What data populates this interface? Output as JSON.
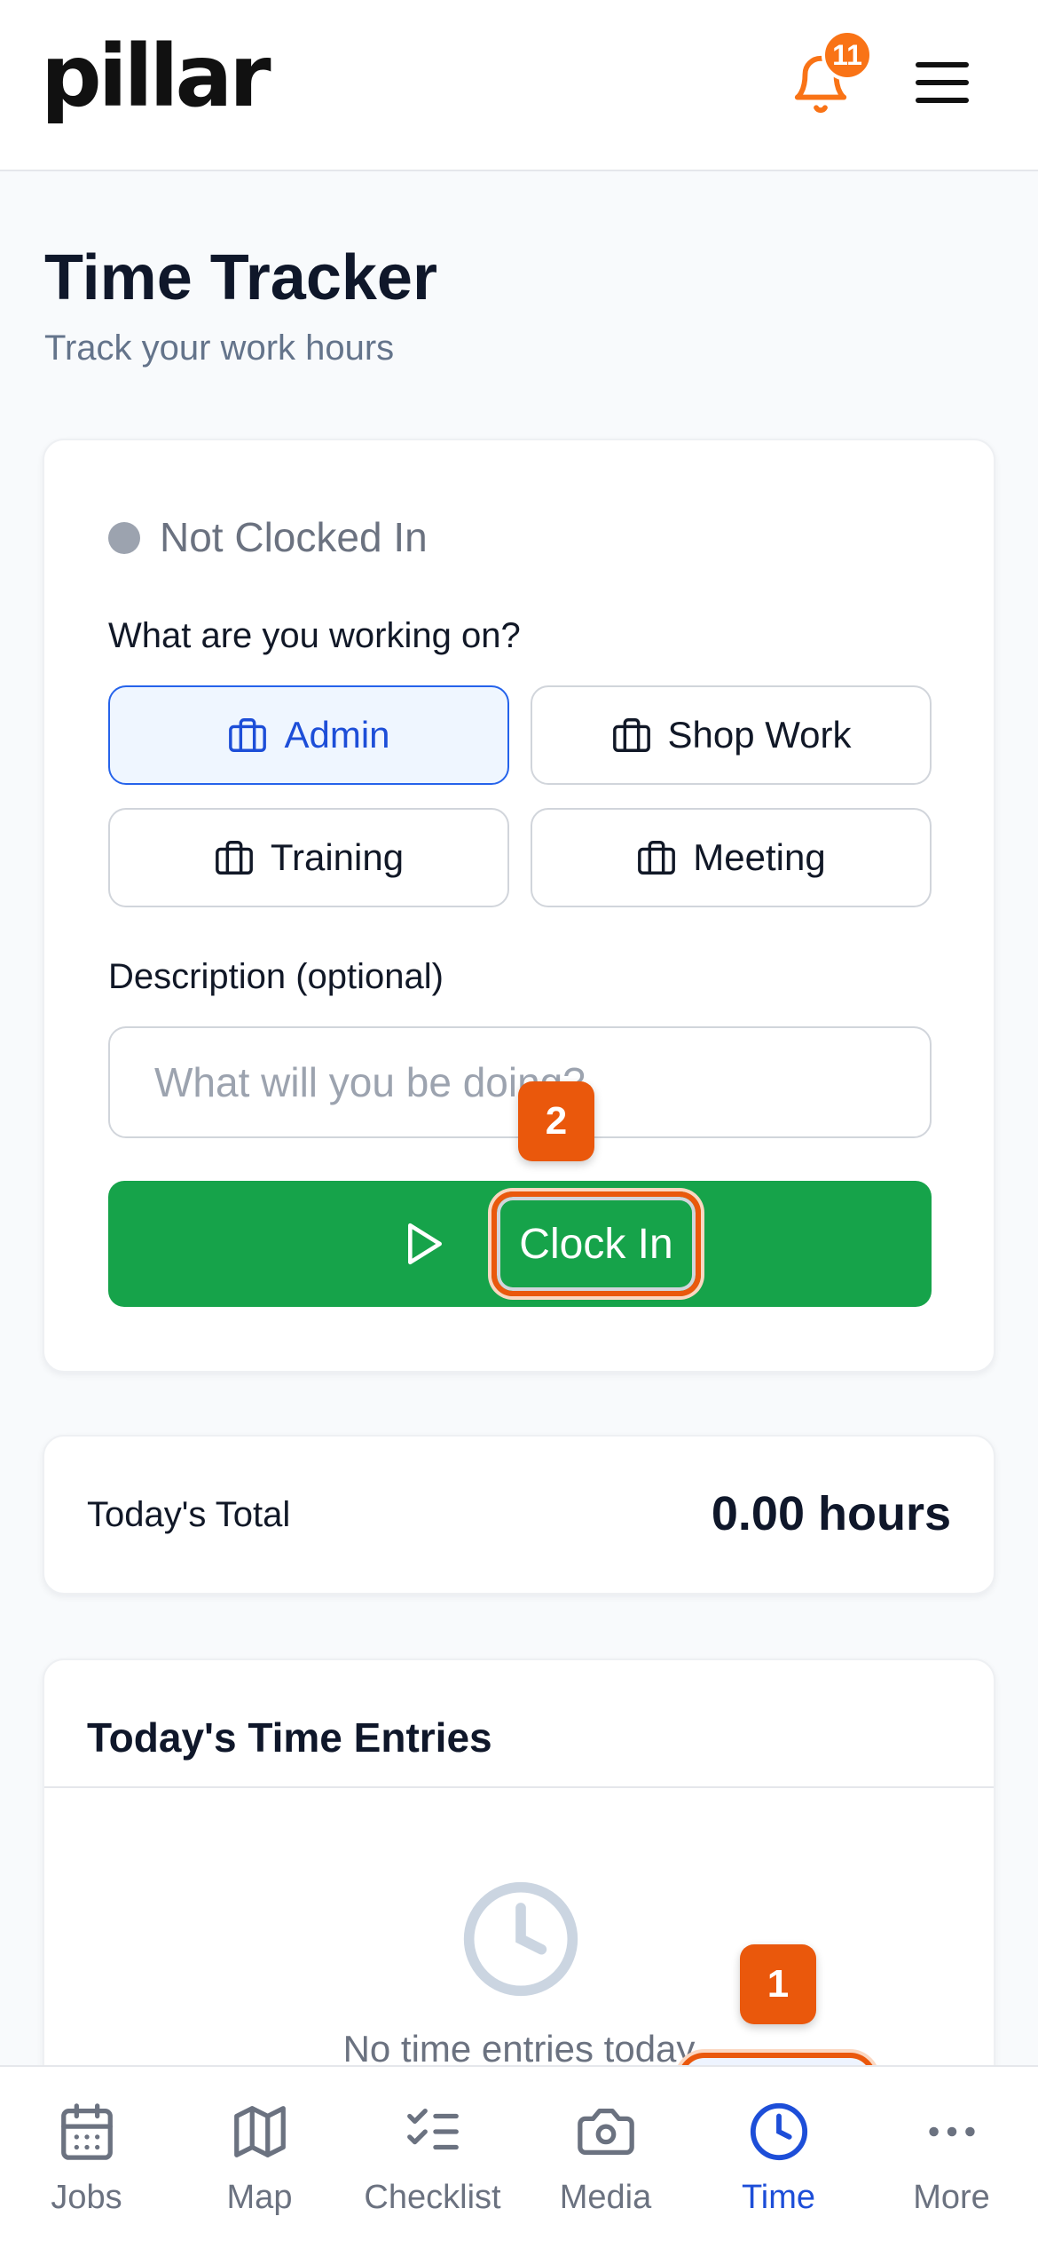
{
  "header": {
    "logo": "pillar",
    "notification_count": "11"
  },
  "page": {
    "title": "Time Tracker",
    "subtitle": "Track your work hours"
  },
  "tracker": {
    "status": "Not Clocked In",
    "work_label": "What are you working on?",
    "categories": [
      {
        "label": "Admin",
        "selected": true
      },
      {
        "label": "Shop Work",
        "selected": false
      },
      {
        "label": "Training",
        "selected": false
      },
      {
        "label": "Meeting",
        "selected": false
      }
    ],
    "description_label": "Description (optional)",
    "description_placeholder": "What will you be doing?",
    "description_value": "",
    "clock_in_label": "Clock In"
  },
  "total": {
    "label": "Today's Total",
    "value": "0.00 hours"
  },
  "entries": {
    "title": "Today's Time Entries",
    "empty_text": "No time entries today"
  },
  "annotations": {
    "step_1": "1",
    "step_2": "2"
  },
  "nav": {
    "items": [
      {
        "label": "Jobs",
        "icon": "calendar-icon"
      },
      {
        "label": "Map",
        "icon": "map-icon"
      },
      {
        "label": "Checklist",
        "icon": "checklist-icon"
      },
      {
        "label": "Media",
        "icon": "camera-icon"
      },
      {
        "label": "Time",
        "icon": "clock-icon",
        "active": true
      },
      {
        "label": "More",
        "icon": "more-icon"
      }
    ]
  },
  "colors": {
    "accent_blue": "#2563eb",
    "success_green": "#16a34a",
    "notification_orange": "#f97316",
    "annotation_orange": "#ea580c"
  }
}
